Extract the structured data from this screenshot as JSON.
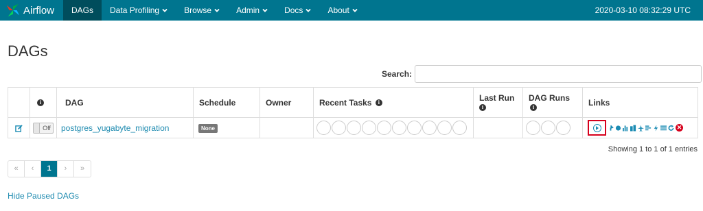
{
  "navbar": {
    "brand": "Airflow",
    "items": [
      {
        "label": "DAGs",
        "active": true,
        "dropdown": false
      },
      {
        "label": "Data Profiling",
        "active": false,
        "dropdown": true
      },
      {
        "label": "Browse",
        "active": false,
        "dropdown": true
      },
      {
        "label": "Admin",
        "active": false,
        "dropdown": true
      },
      {
        "label": "Docs",
        "active": false,
        "dropdown": true
      },
      {
        "label": "About",
        "active": false,
        "dropdown": true
      }
    ],
    "time": "2020-03-10 08:32:29 UTC",
    "color": "#00758f"
  },
  "page": {
    "title": "DAGs",
    "search_label": "Search:",
    "search_value": ""
  },
  "table": {
    "headers": {
      "info": "",
      "dag": "DAG",
      "schedule": "Schedule",
      "owner": "Owner",
      "recent_tasks": "Recent Tasks",
      "last_run": "Last Run",
      "dag_runs": "DAG Runs",
      "links": "Links"
    },
    "rows": [
      {
        "toggle": "Off",
        "dag_id": "postgres_yugabyte_migration",
        "schedule": "None",
        "owner": "",
        "last_run": ""
      }
    ],
    "link_icons": [
      "trigger-dag-icon",
      "tree-view-icon",
      "graph-view-icon",
      "task-duration-icon",
      "task-tries-icon",
      "landing-times-icon",
      "gantt-icon",
      "code-icon",
      "logs-icon",
      "refresh-icon",
      "delete-icon"
    ]
  },
  "footer": {
    "showing": "Showing 1 to 1 of 1 entries",
    "pager": [
      "«",
      "‹",
      "1",
      "›",
      "»"
    ],
    "hide_paused": "Hide Paused DAGs"
  }
}
